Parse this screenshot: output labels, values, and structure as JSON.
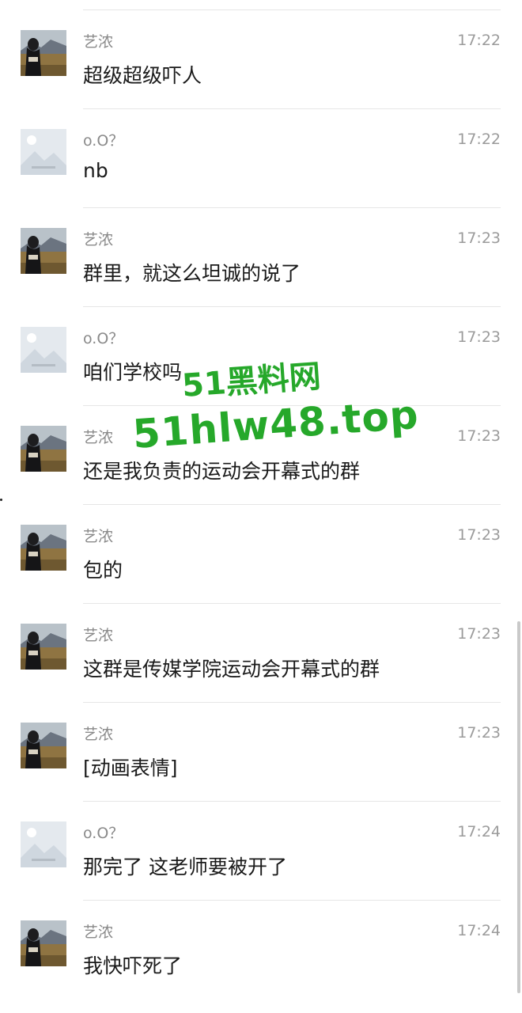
{
  "messages": [
    {
      "sender": "艺浓",
      "avatar": "landscape-avatar",
      "time": "17:22",
      "text": "超级超级吓人"
    },
    {
      "sender": "o.O？",
      "avatar": "placeholder-avatar",
      "time": "17:22",
      "text": "nb"
    },
    {
      "sender": "艺浓",
      "avatar": "landscape-avatar",
      "time": "17:23",
      "text": "群里，就这么坦诚的说了"
    },
    {
      "sender": "o.O？",
      "avatar": "placeholder-avatar",
      "time": "17:23",
      "text": "咱们学校吗"
    },
    {
      "sender": "艺浓",
      "avatar": "landscape-avatar",
      "time": "17:23",
      "text": "还是我负责的运动会开幕式的群"
    },
    {
      "sender": "艺浓",
      "avatar": "landscape-avatar",
      "time": "17:23",
      "text": "包的"
    },
    {
      "sender": "艺浓",
      "avatar": "landscape-avatar",
      "time": "17:23",
      "text": "这群是传媒学院运动会开幕式的群"
    },
    {
      "sender": "艺浓",
      "avatar": "landscape-avatar",
      "time": "17:23",
      "text": "[动画表情]"
    },
    {
      "sender": "o.O？",
      "avatar": "placeholder-avatar",
      "time": "17:24",
      "text": "那完了 这老师要被开了"
    },
    {
      "sender": "艺浓",
      "avatar": "landscape-avatar",
      "time": "17:24",
      "text": "我快吓死了"
    }
  ],
  "watermark": {
    "line1": "51黑料网",
    "line2": "51hlw48.top",
    "color": "#26a82a"
  },
  "colors": {
    "sender": "#8a8a8a",
    "time": "#9b9b9b",
    "message": "#1a1a1a",
    "divider": "#e6e6e6"
  }
}
